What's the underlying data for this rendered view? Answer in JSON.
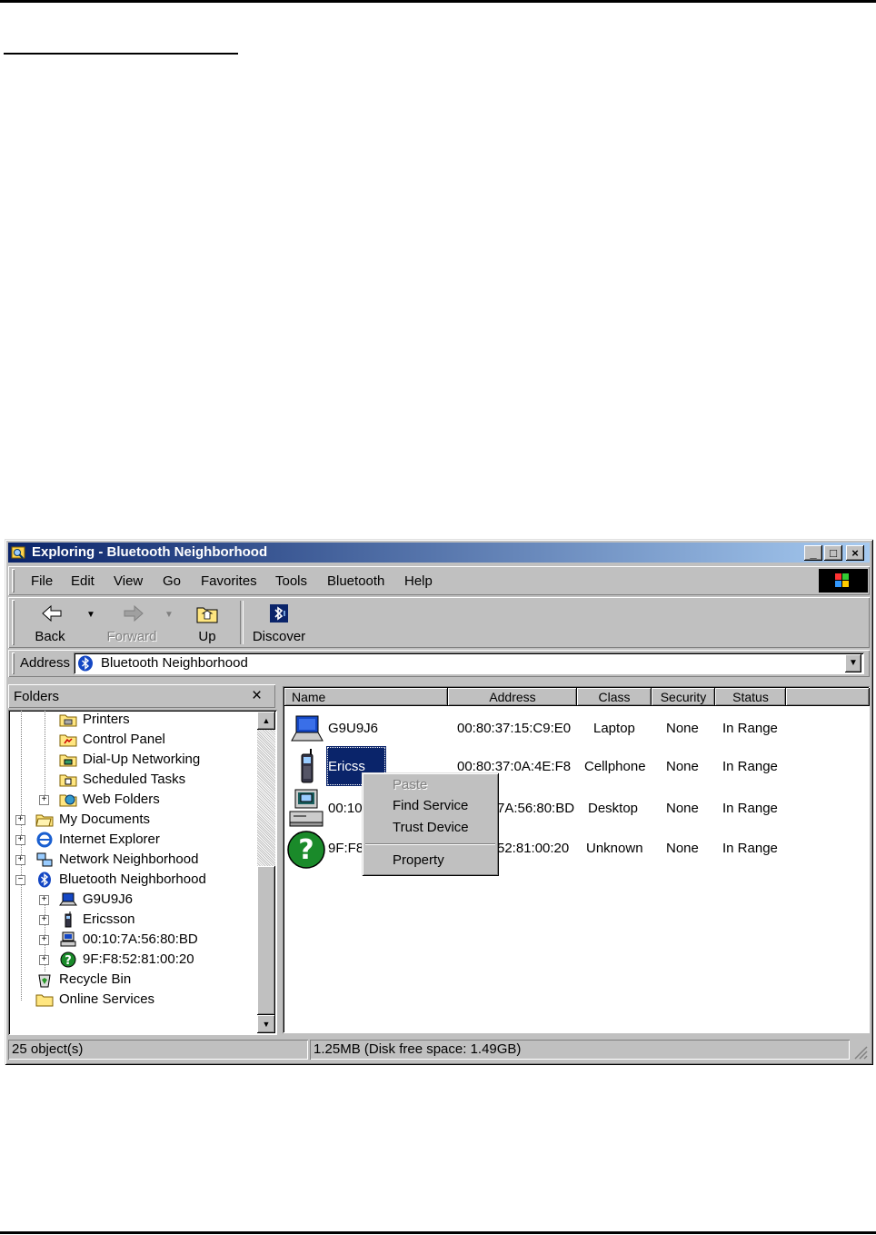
{
  "window": {
    "title": "Exploring - Bluetooth Neighborhood",
    "minimize": "_",
    "maximize": "□",
    "close": "×"
  },
  "menu": {
    "items": [
      {
        "label": "File"
      },
      {
        "label": "Edit"
      },
      {
        "label": "View"
      },
      {
        "label": "Go"
      },
      {
        "label": "Favorites"
      },
      {
        "label": "Tools"
      },
      {
        "label": "Bluetooth"
      },
      {
        "label": "Help"
      }
    ]
  },
  "toolbar": {
    "back_label": "Back",
    "forward_label": "Forward",
    "up_label": "Up",
    "discover_label": "Discover"
  },
  "address": {
    "label": "Address",
    "value": "Bluetooth Neighborhood"
  },
  "folders": {
    "title": "Folders",
    "close": "×",
    "items": [
      {
        "label": "Printers",
        "icon": "printers-folder-icon"
      },
      {
        "label": "Control Panel",
        "icon": "control-panel-icon"
      },
      {
        "label": "Dial-Up Networking",
        "icon": "dialup-networking-icon"
      },
      {
        "label": "Scheduled Tasks",
        "icon": "scheduled-tasks-icon"
      },
      {
        "label": "Web Folders",
        "icon": "web-folders-icon"
      },
      {
        "label": "My Documents",
        "icon": "my-documents-icon"
      },
      {
        "label": "Internet Explorer",
        "icon": "internet-explorer-icon"
      },
      {
        "label": "Network Neighborhood",
        "icon": "network-neighborhood-icon"
      },
      {
        "label": "Bluetooth Neighborhood",
        "icon": "bluetooth-icon"
      },
      {
        "label": "G9U9J6",
        "icon": "laptop-icon"
      },
      {
        "label": "Ericsson",
        "icon": "cellphone-icon"
      },
      {
        "label": "00:10:7A:56:80:BD",
        "icon": "desktop-computer-icon"
      },
      {
        "label": "9F:F8:52:81:00:20",
        "icon": "unknown-device-icon"
      },
      {
        "label": "Recycle Bin",
        "icon": "recycle-bin-icon"
      },
      {
        "label": "Online Services",
        "icon": "folder-icon"
      }
    ]
  },
  "list": {
    "columns": [
      "Name",
      "Address",
      "Class",
      "Security",
      "Status"
    ],
    "rows": [
      {
        "name": "G9U9J6",
        "address": "00:80:37:15:C9:E0",
        "class": "Laptop",
        "security": "None",
        "status": "In Range"
      },
      {
        "name": "Ericsson",
        "address": "00:80:37:0A:4E:F8",
        "class": "Cellphone",
        "security": "None",
        "status": "In Range"
      },
      {
        "name": "00:10:7A:56:80:BD",
        "address": "00:10:7A:56:80:BD",
        "class": "Desktop",
        "security": "None",
        "status": "In Range"
      },
      {
        "name": "9F:F8:52:81:00:20",
        "address": "9F:F8:52:81:00:20",
        "class": "Unknown",
        "security": "None",
        "status": "In Range"
      }
    ],
    "visible": {
      "row1_name": "Ericss",
      "row2_name": "00:10",
      "row3_name": "9F:F8",
      "row1_addr": "00:80:37:0A:4E:F8",
      "row2_addr": "7A:56:80:BD",
      "row3_addr": "52:81:00:20"
    }
  },
  "context_menu": {
    "paste": "Paste",
    "find_service": "Find Service",
    "trust_device": "Trust Device",
    "property": "Property"
  },
  "status_bar": {
    "objects": "25 object(s)",
    "disk": "1.25MB (Disk free space: 1.49GB)"
  },
  "colors": {
    "title_start": "#0a246a",
    "title_end": "#a6caf0",
    "face": "#c0c0c0",
    "selection": "#0a246a"
  }
}
